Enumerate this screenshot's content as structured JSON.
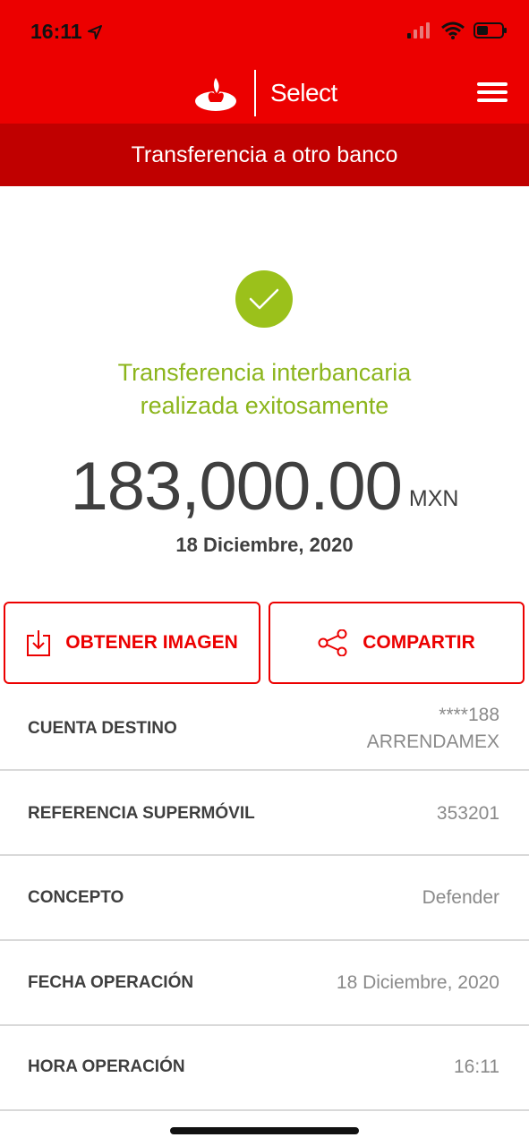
{
  "status_bar": {
    "time": "16:11"
  },
  "header": {
    "brand_text": "Select",
    "subheader_title": "Transferencia a otro banco",
    "brand_color": "#ec0000"
  },
  "success": {
    "message_line1": "Transferencia interbancaria",
    "message_line2": "realizada exitosamente",
    "amount": "183,000.00",
    "currency": "MXN",
    "date": "18 Diciembre, 2020",
    "accent_color": "#9bc11b"
  },
  "actions": {
    "get_image_label": "OBTENER IMAGEN",
    "share_label": "COMPARTIR"
  },
  "details": [
    {
      "label": "CUENTA DESTINO",
      "value_lines": [
        "****188",
        "ARRENDAMEX"
      ]
    },
    {
      "label": "REFERENCIA SUPERMÓVIL",
      "value_lines": [
        "353201"
      ]
    },
    {
      "label": "CONCEPTO",
      "value_lines": [
        "Defender"
      ]
    },
    {
      "label": "FECHA OPERACIÓN",
      "value_lines": [
        "18 Diciembre, 2020"
      ]
    },
    {
      "label": "HORA OPERACIÓN",
      "value_lines": [
        "16:11"
      ]
    }
  ],
  "icons": [
    "location-arrow-icon",
    "signal-icon",
    "wifi-icon",
    "battery-icon",
    "santander-flame-icon",
    "menu-icon",
    "checkmark-icon",
    "download-icon",
    "share-icon"
  ]
}
